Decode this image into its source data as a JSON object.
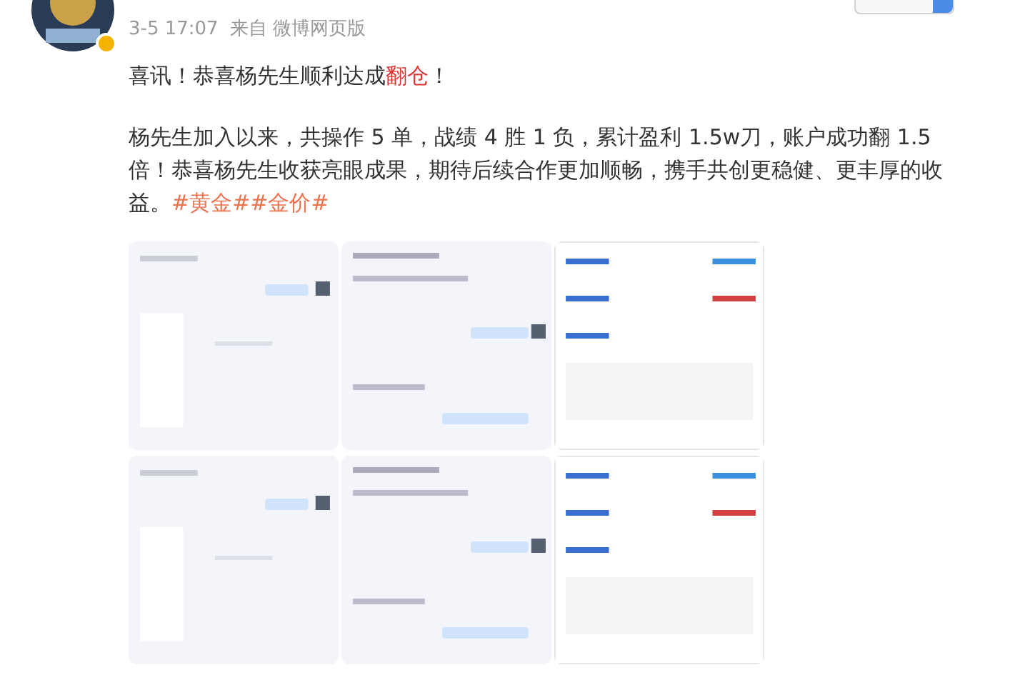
{
  "post": {
    "time": "3-5 17:07",
    "source_prefix": "来自",
    "source": "微博网页版",
    "verified": true,
    "headline": [
      {
        "text": "喜讯！恭喜杨先生顺利达成",
        "highlight": false
      },
      {
        "text": "翻仓",
        "highlight": true
      },
      {
        "text": "！",
        "highlight": false
      }
    ],
    "body": "杨先生加入以来，共操作 5 单，战绩 4 胜 1 负，累计盈利 1.5w刀，账户成功翻 1.5 倍！恭喜杨先生收获亮眼成果，期待后续合作更加顺畅，携手共创更稳健、更丰厚的收益。",
    "hashtags": [
      "#黄金#",
      "#金价#"
    ],
    "images": [
      {
        "kind": "picture"
      },
      {
        "kind": "picture"
      },
      {
        "kind": "picture"
      },
      {
        "kind": "picture"
      },
      {
        "kind": "picture"
      },
      {
        "kind": "picture"
      }
    ]
  }
}
